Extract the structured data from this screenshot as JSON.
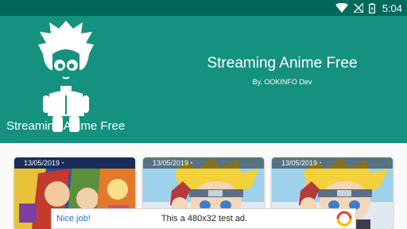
{
  "status_bar": {
    "time": "5:04",
    "icons": [
      "wifi-icon",
      "no-signal-icon",
      "battery-icon"
    ]
  },
  "header": {
    "brand_name": "Streaming Anime Free",
    "title": "Streaming Anime Free",
    "subtitle": "By. OOKINFO Dev"
  },
  "cards": [
    {
      "date": "13/05/2019",
      "dot": "•",
      "thumbnail": "one-piece-crew-artwork"
    },
    {
      "date": "13/05/2019",
      "dot": "•",
      "thumbnail": "boruto-artwork"
    },
    {
      "date": "13/05/2019",
      "dot": "•",
      "thumbnail": "boruto-artwork"
    }
  ],
  "ad": {
    "label": "Nice job!",
    "text": "This a 480x32 test ad.",
    "logo": "ad-network-icon"
  },
  "colors": {
    "status_bar": "#00695c",
    "header": "#15917f",
    "background": "#fafafa",
    "ad_link": "#1a73e8"
  }
}
